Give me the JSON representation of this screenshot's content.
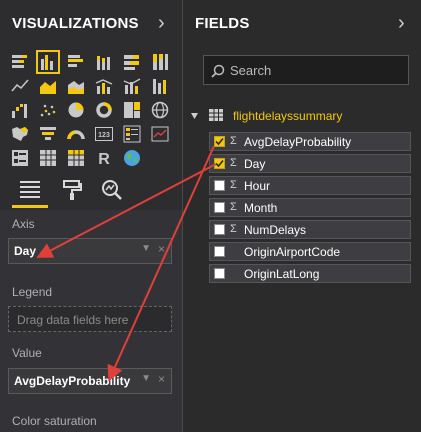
{
  "visualizations": {
    "title": "VISUALIZATIONS",
    "collapse_glyph": "›",
    "icons": [
      "stacked-bar-icon",
      "clustered-column-icon",
      "clustered-bar-icon",
      "stacked-column-icon",
      "100-bar-icon",
      "100-column-icon",
      "line-chart-icon",
      "area-chart-icon",
      "stacked-area-icon",
      "line-column-icon",
      "line-column-2-icon",
      "ribbon-chart-icon",
      "waterfall-icon",
      "scatter-icon",
      "pie-chart-icon",
      "donut-chart-icon",
      "treemap-icon",
      "globe-icon",
      "filled-map-icon",
      "funnel-icon",
      "gauge-icon",
      "card-icon",
      "multirow-card-icon",
      "kpi-icon",
      "slicer-icon",
      "table-icon",
      "matrix-icon",
      "r-visual-icon",
      "globe-map-icon"
    ],
    "r_glyph": "R",
    "card_glyph": "123",
    "selected_icon": "clustered-column-icon",
    "subtabs": [
      "fields-tab",
      "format-tab",
      "analytics-tab"
    ]
  },
  "wells": {
    "axis_label": "Axis",
    "axis_value": "Day",
    "legend_label": "Legend",
    "legend_placeholder": "Drag data fields here",
    "value_label": "Value",
    "value_value": "AvgDelayProbability",
    "color_saturation_label": "Color saturation",
    "caret_glyph": "▼",
    "remove_glyph": "×"
  },
  "fields": {
    "title": "FIELDS",
    "collapse_glyph": "›",
    "search_placeholder": "Search",
    "table_name": "flightdelayssummary",
    "sigma_glyph": "Σ",
    "items": [
      {
        "name": "AvgDelayProbability",
        "checked": true,
        "sigma": true
      },
      {
        "name": "Day",
        "checked": true,
        "sigma": true
      },
      {
        "name": "Hour",
        "checked": false,
        "sigma": true
      },
      {
        "name": "Month",
        "checked": false,
        "sigma": true
      },
      {
        "name": "NumDelays",
        "checked": false,
        "sigma": true
      },
      {
        "name": "OriginAirportCode",
        "checked": false,
        "sigma": false
      },
      {
        "name": "OriginLatLong",
        "checked": false,
        "sigma": false
      }
    ]
  },
  "colors": {
    "accent_yellow": "#f2c811",
    "annotation_red": "#e0403a"
  }
}
